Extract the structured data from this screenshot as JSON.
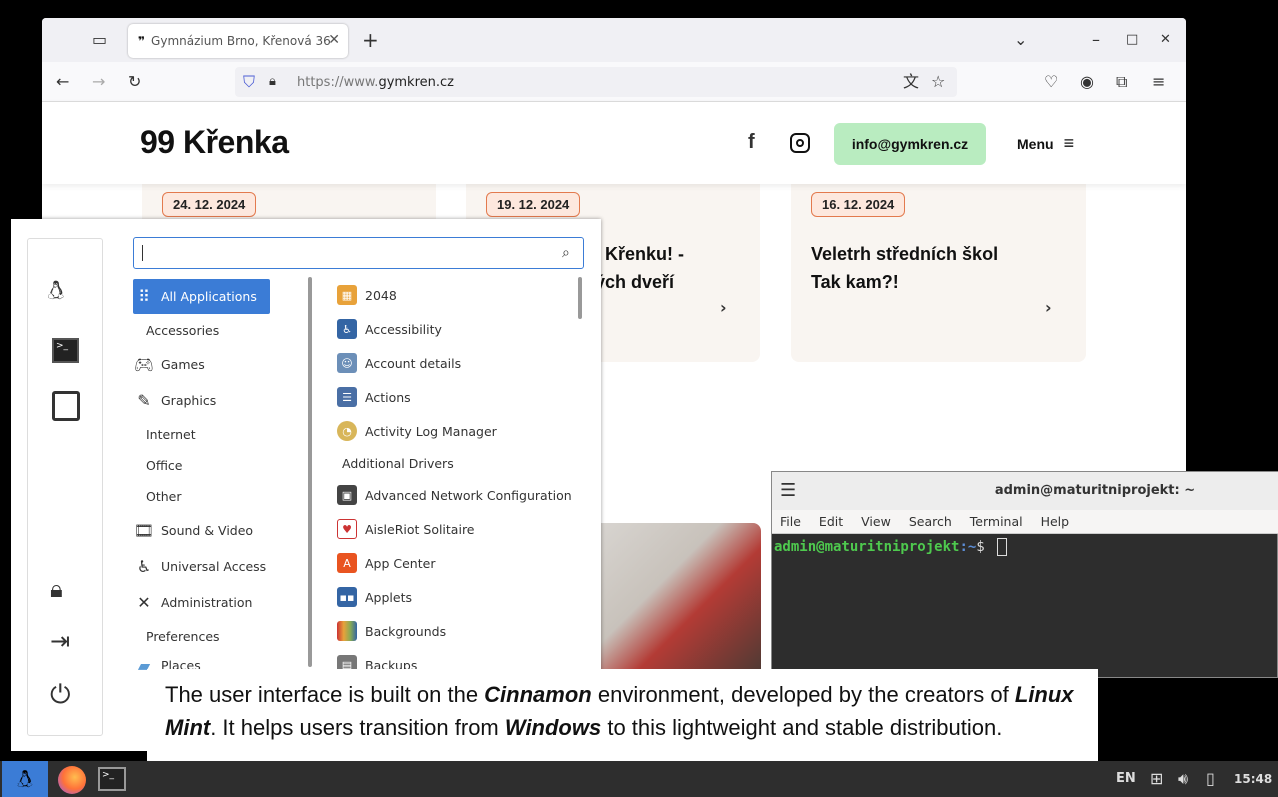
{
  "browser": {
    "tab_title": "Gymnázium Brno, Křenová 36",
    "url_prefix": "https://www.",
    "url_domain": "gymkren.cz"
  },
  "site": {
    "logo": "99 Křenka",
    "email": "info@gymkren.cz",
    "menu_label": "Menu",
    "cards": [
      {
        "date": "24. 12. 2024",
        "title": ""
      },
      {
        "date": "19. 12. 2024",
        "title_line1": "Křenku! -",
        "title_line2": "ých dveří"
      },
      {
        "date": "16. 12. 2024",
        "title_line1": "Veletrh středních škol",
        "title_line2": "Tak kam?!"
      }
    ]
  },
  "menu": {
    "search_value": "",
    "categories": [
      {
        "label": "All Applications",
        "icon": "grid-icon"
      },
      {
        "label": "Accessories",
        "icon": ""
      },
      {
        "label": "Games",
        "icon": "gamepad-icon"
      },
      {
        "label": "Graphics",
        "icon": "graphics-icon"
      },
      {
        "label": "Internet",
        "icon": ""
      },
      {
        "label": "Office",
        "icon": ""
      },
      {
        "label": "Other",
        "icon": ""
      },
      {
        "label": "Sound & Video",
        "icon": "film-icon"
      },
      {
        "label": "Universal Access",
        "icon": "accessibility-icon"
      },
      {
        "label": "Administration",
        "icon": "tools-icon"
      },
      {
        "label": "Preferences",
        "icon": ""
      },
      {
        "label": "Places",
        "icon": "folder-icon"
      }
    ],
    "apps": [
      {
        "label": "2048",
        "color": "#e8a23a"
      },
      {
        "label": "Accessibility",
        "color": "#3465a4"
      },
      {
        "label": "Account details",
        "color": "#6c8fb8"
      },
      {
        "label": "Actions",
        "color": "#4a6fa5"
      },
      {
        "label": "Activity Log Manager",
        "color": "#d8b65a"
      },
      {
        "label": "Additional Drivers",
        "color": ""
      },
      {
        "label": "Advanced Network Configuration",
        "color": "#444"
      },
      {
        "label": "AisleRiot Solitaire",
        "color": "#c33"
      },
      {
        "label": "App Center",
        "color": "#e95420"
      },
      {
        "label": "Applets",
        "color": "#3465a4"
      },
      {
        "label": "Backgrounds",
        "color": "#8a5"
      },
      {
        "label": "Backups",
        "color": "#777"
      }
    ]
  },
  "terminal": {
    "title": "admin@maturitniprojekt: ~",
    "menus": [
      "File",
      "Edit",
      "View",
      "Search",
      "Terminal",
      "Help"
    ],
    "prompt_user": "admin@maturitniprojekt",
    "prompt_path": ":~",
    "prompt_symbol": "$"
  },
  "caption": {
    "p1": "The user interface is built on the ",
    "e1": "Cinnamon",
    "p2": " environment, developed by the creators of ",
    "e2": "Linux Mint",
    "p3": ". It helps users transition from ",
    "e3": "Windows",
    "p4": " to this lightweight and stable distribution."
  },
  "taskbar": {
    "keyboard": "EN",
    "clock": "15:48"
  }
}
